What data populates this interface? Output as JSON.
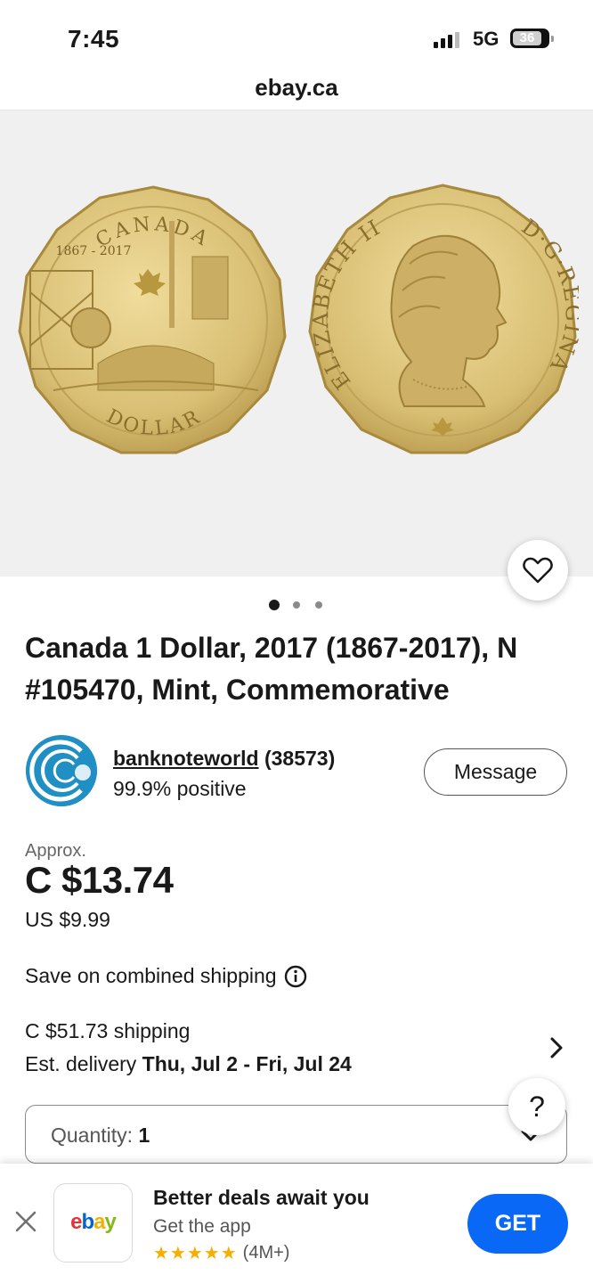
{
  "status_bar": {
    "time": "7:45",
    "network": "5G",
    "battery": "36"
  },
  "browser": {
    "url": "ebay.ca"
  },
  "gallery": {
    "coin_obverse_text_top": "CANADA",
    "coin_obverse_years": "1867 - 2017",
    "coin_obverse_text_bottom": "DOLLAR",
    "coin_reverse_text_left": "ELIZABETH II",
    "coin_reverse_text_right": "D·G·REGINA",
    "image_count": 3,
    "current_image": 1
  },
  "listing": {
    "title": "Canada 1 Dollar, 2017 (1867-2017), N #105470, Mint, Commemorative"
  },
  "seller": {
    "name": "banknoteworld",
    "feedback_count": "(38573)",
    "positive": "99.9% positive",
    "message_label": "Message"
  },
  "price": {
    "approx_label": "Approx.",
    "cad": "C $13.74",
    "usd": "US $9.99"
  },
  "shipping": {
    "combined_label": "Save on combined shipping",
    "cost": "C $51.73 shipping",
    "delivery_prefix": "Est. delivery",
    "delivery_dates": "Thu, Jul 2 - Fri, Jul 24"
  },
  "quantity": {
    "label": "Quantity:",
    "value": "1"
  },
  "help": {
    "label": "?"
  },
  "app_banner": {
    "title": "Better deals await you",
    "subtitle": "Get the app",
    "stars": "★★★★★",
    "rating_count": "(4M+)",
    "get_label": "GET",
    "logo_e": "e",
    "logo_b": "b",
    "logo_a": "a",
    "logo_y": "y"
  },
  "colors": {
    "accent": "#0968f6",
    "star": "#f5af02",
    "gallery_bg": "#f0f0f0",
    "coin_gold": "#d9bf74"
  }
}
